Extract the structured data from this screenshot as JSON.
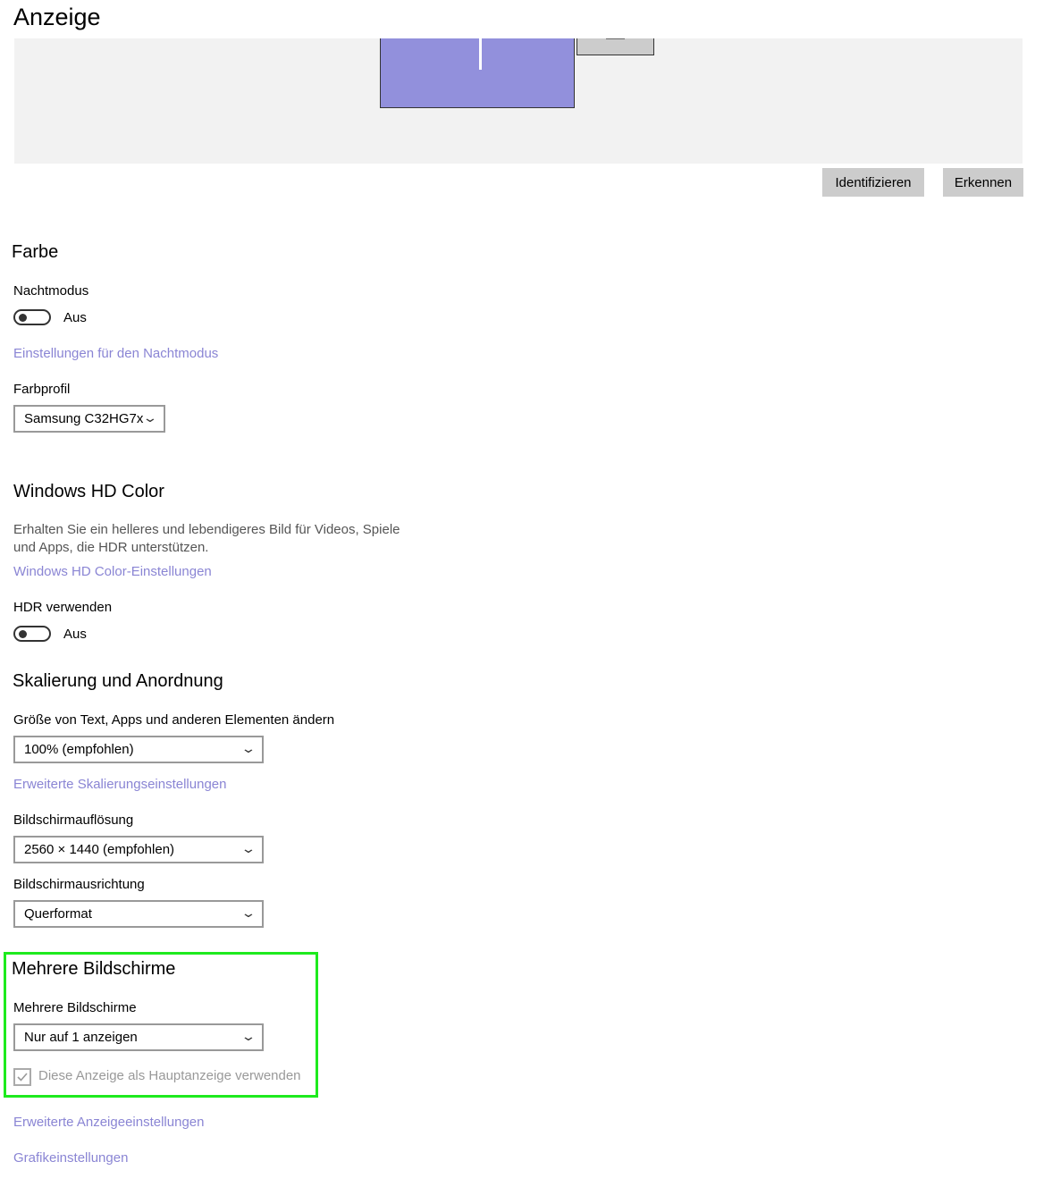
{
  "page": {
    "title": "Anzeige"
  },
  "arrangement": {
    "buttons": {
      "identify": "Identifizieren",
      "detect": "Erkennen"
    },
    "monitor_color": "#9290dc"
  },
  "color": {
    "heading": "Farbe",
    "night_mode": {
      "label": "Nachtmodus",
      "state": "Aus",
      "on": false
    },
    "night_mode_link": "Einstellungen für den Nachtmodus",
    "profile": {
      "label": "Farbprofil",
      "value": "Samsung C32HG7x"
    }
  },
  "hd_color": {
    "heading": "Windows HD Color",
    "description": "Erhalten Sie ein helleres und lebendigeres Bild für Videos, Spiele und Apps, die HDR unterstützen.",
    "link": "Windows HD Color-Einstellungen",
    "hdr": {
      "label": "HDR verwenden",
      "state": "Aus",
      "on": false
    }
  },
  "scaling": {
    "heading": "Skalierung und Anordnung",
    "size": {
      "label": "Größe von Text, Apps und anderen Elementen ändern",
      "value": "100% (empfohlen)"
    },
    "advanced_link": "Erweiterte Skalierungseinstellungen",
    "resolution": {
      "label": "Bildschirmauflösung",
      "value": "2560 × 1440 (empfohlen)"
    },
    "orientation": {
      "label": "Bildschirmausrichtung",
      "value": "Querformat"
    }
  },
  "multi": {
    "heading": "Mehrere Bildschirme",
    "select": {
      "label": "Mehrere Bildschirme",
      "value": "Nur auf 1 anzeigen"
    },
    "main_display": {
      "label": "Diese Anzeige als Hauptanzeige verwenden",
      "checked": true,
      "disabled": true
    },
    "highlight_color": "#1eea1e"
  },
  "links": {
    "advanced_display": "Erweiterte Anzeigeeinstellungen",
    "graphics": "Grafikeinstellungen"
  },
  "colors": {
    "link": "#8a85d4",
    "button_bg": "#cccccc",
    "preview_bg": "#f2f2f2"
  }
}
